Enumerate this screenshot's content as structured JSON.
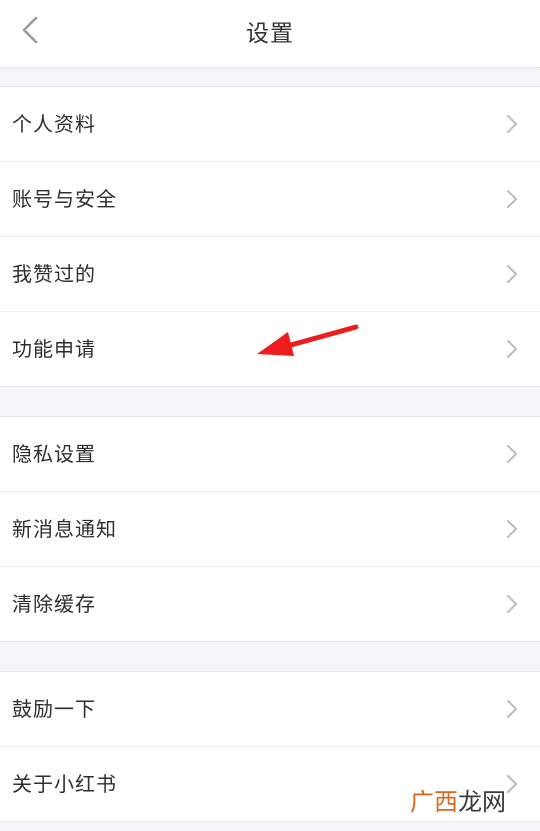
{
  "header": {
    "title": "设置",
    "back_icon": "chevron-left-icon"
  },
  "sections": [
    {
      "items": [
        {
          "label": "个人资料"
        },
        {
          "label": "账号与安全"
        },
        {
          "label": "我赞过的"
        },
        {
          "label": "功能申请"
        }
      ]
    },
    {
      "items": [
        {
          "label": "隐私设置"
        },
        {
          "label": "新消息通知"
        },
        {
          "label": "清除缓存"
        }
      ]
    },
    {
      "items": [
        {
          "label": "鼓励一下"
        },
        {
          "label": "关于小红书"
        }
      ]
    }
  ],
  "annotation": {
    "arrow_color": "#ee1c1c",
    "points_to": "功能申请"
  },
  "watermark": {
    "part1": "广西",
    "part2": "龙网",
    "color_part1": "#d9681e"
  },
  "colors": {
    "background": "#f4f6f9",
    "row_background": "#ffffff",
    "text": "#2e2e2e",
    "chevron": "#b8bcc2"
  }
}
